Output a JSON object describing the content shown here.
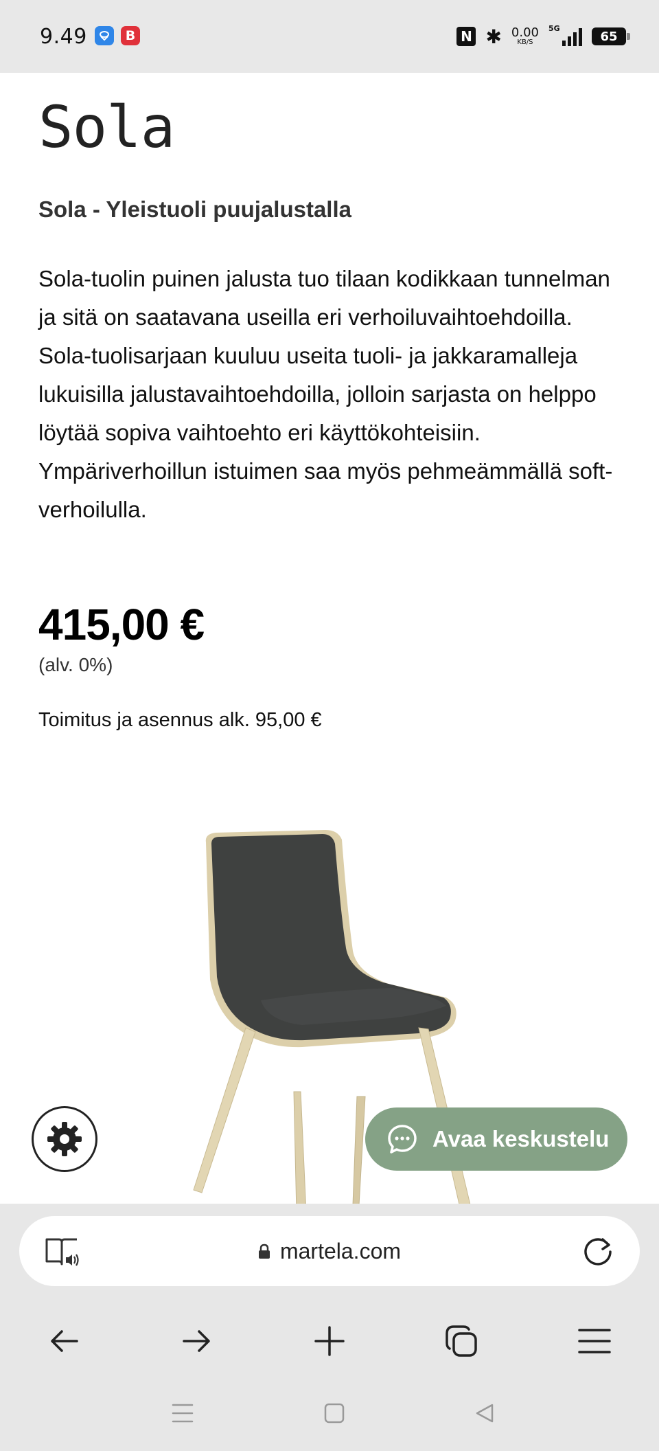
{
  "status_bar": {
    "time": "9.49",
    "app_badge_2": "B",
    "nfc": "N",
    "net_speed_value": "0.00",
    "net_speed_unit": "KB/S",
    "network": "5G",
    "battery": "65"
  },
  "product": {
    "title": "Sola",
    "subtitle": "Sola - Yleistuoli puujalustalla",
    "description": "Sola-tuolin puinen jalusta tuo tilaan kodikkaan tunnelman ja sitä on saatavana useilla eri verhoiluvaihtoehdoilla. Sola-tuolisarjaan kuuluu useita tuoli- ja jakkaramalleja lukuisilla jalustavaihtoehdoilla, jolloin sarjasta on helppo löytää sopiva vaihtoehto eri käyttökohteisiin. Ympäriverhoillun istuimen saa myös pehmeämmällä soft-verhoilulla.",
    "price": "415,00 €",
    "vat_note": "(alv. 0%)",
    "delivery": "Toimitus ja asennus alk. 95,00 €"
  },
  "chat": {
    "label": "Avaa keskustelu"
  },
  "browser": {
    "url": "martela.com"
  },
  "colors": {
    "chat_button": "#85a286",
    "chair_fabric": "#3f4140",
    "chair_wood": "#dccfaa",
    "browser_chrome": "#e7e7e7"
  }
}
